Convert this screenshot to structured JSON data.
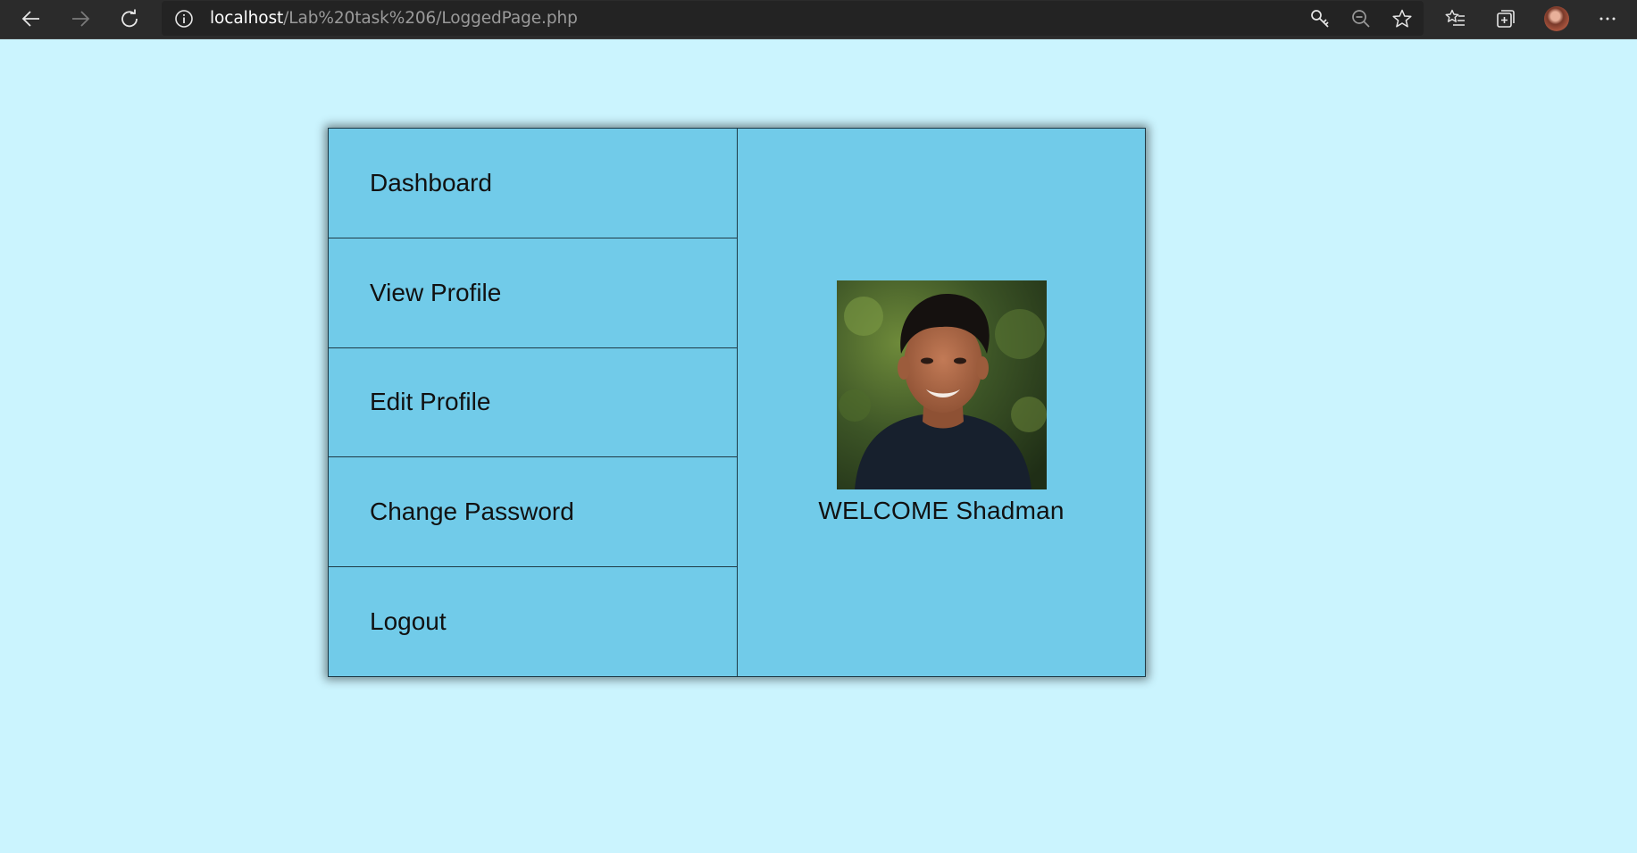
{
  "browser": {
    "url_host": "localhost",
    "url_path": "/Lab%20task%206/LoggedPage.php",
    "icons": [
      "back-icon",
      "forward-icon",
      "refresh-icon",
      "info-icon",
      "key-icon",
      "zoom-out-icon",
      "star-icon",
      "favorites-icon",
      "collections-icon",
      "profile-avatar",
      "more-icon"
    ]
  },
  "menu": {
    "items": [
      {
        "label": "Dashboard"
      },
      {
        "label": "View Profile"
      },
      {
        "label": "Edit Profile"
      },
      {
        "label": "Change Password"
      },
      {
        "label": "Logout"
      }
    ]
  },
  "profile": {
    "welcome": "WELCOME Shadman"
  },
  "colors": {
    "page_bg": "#cbf4fe",
    "card_bg": "#71cbe9",
    "border": "#1e3a46",
    "toolbar_bg": "#2b2b2b"
  }
}
